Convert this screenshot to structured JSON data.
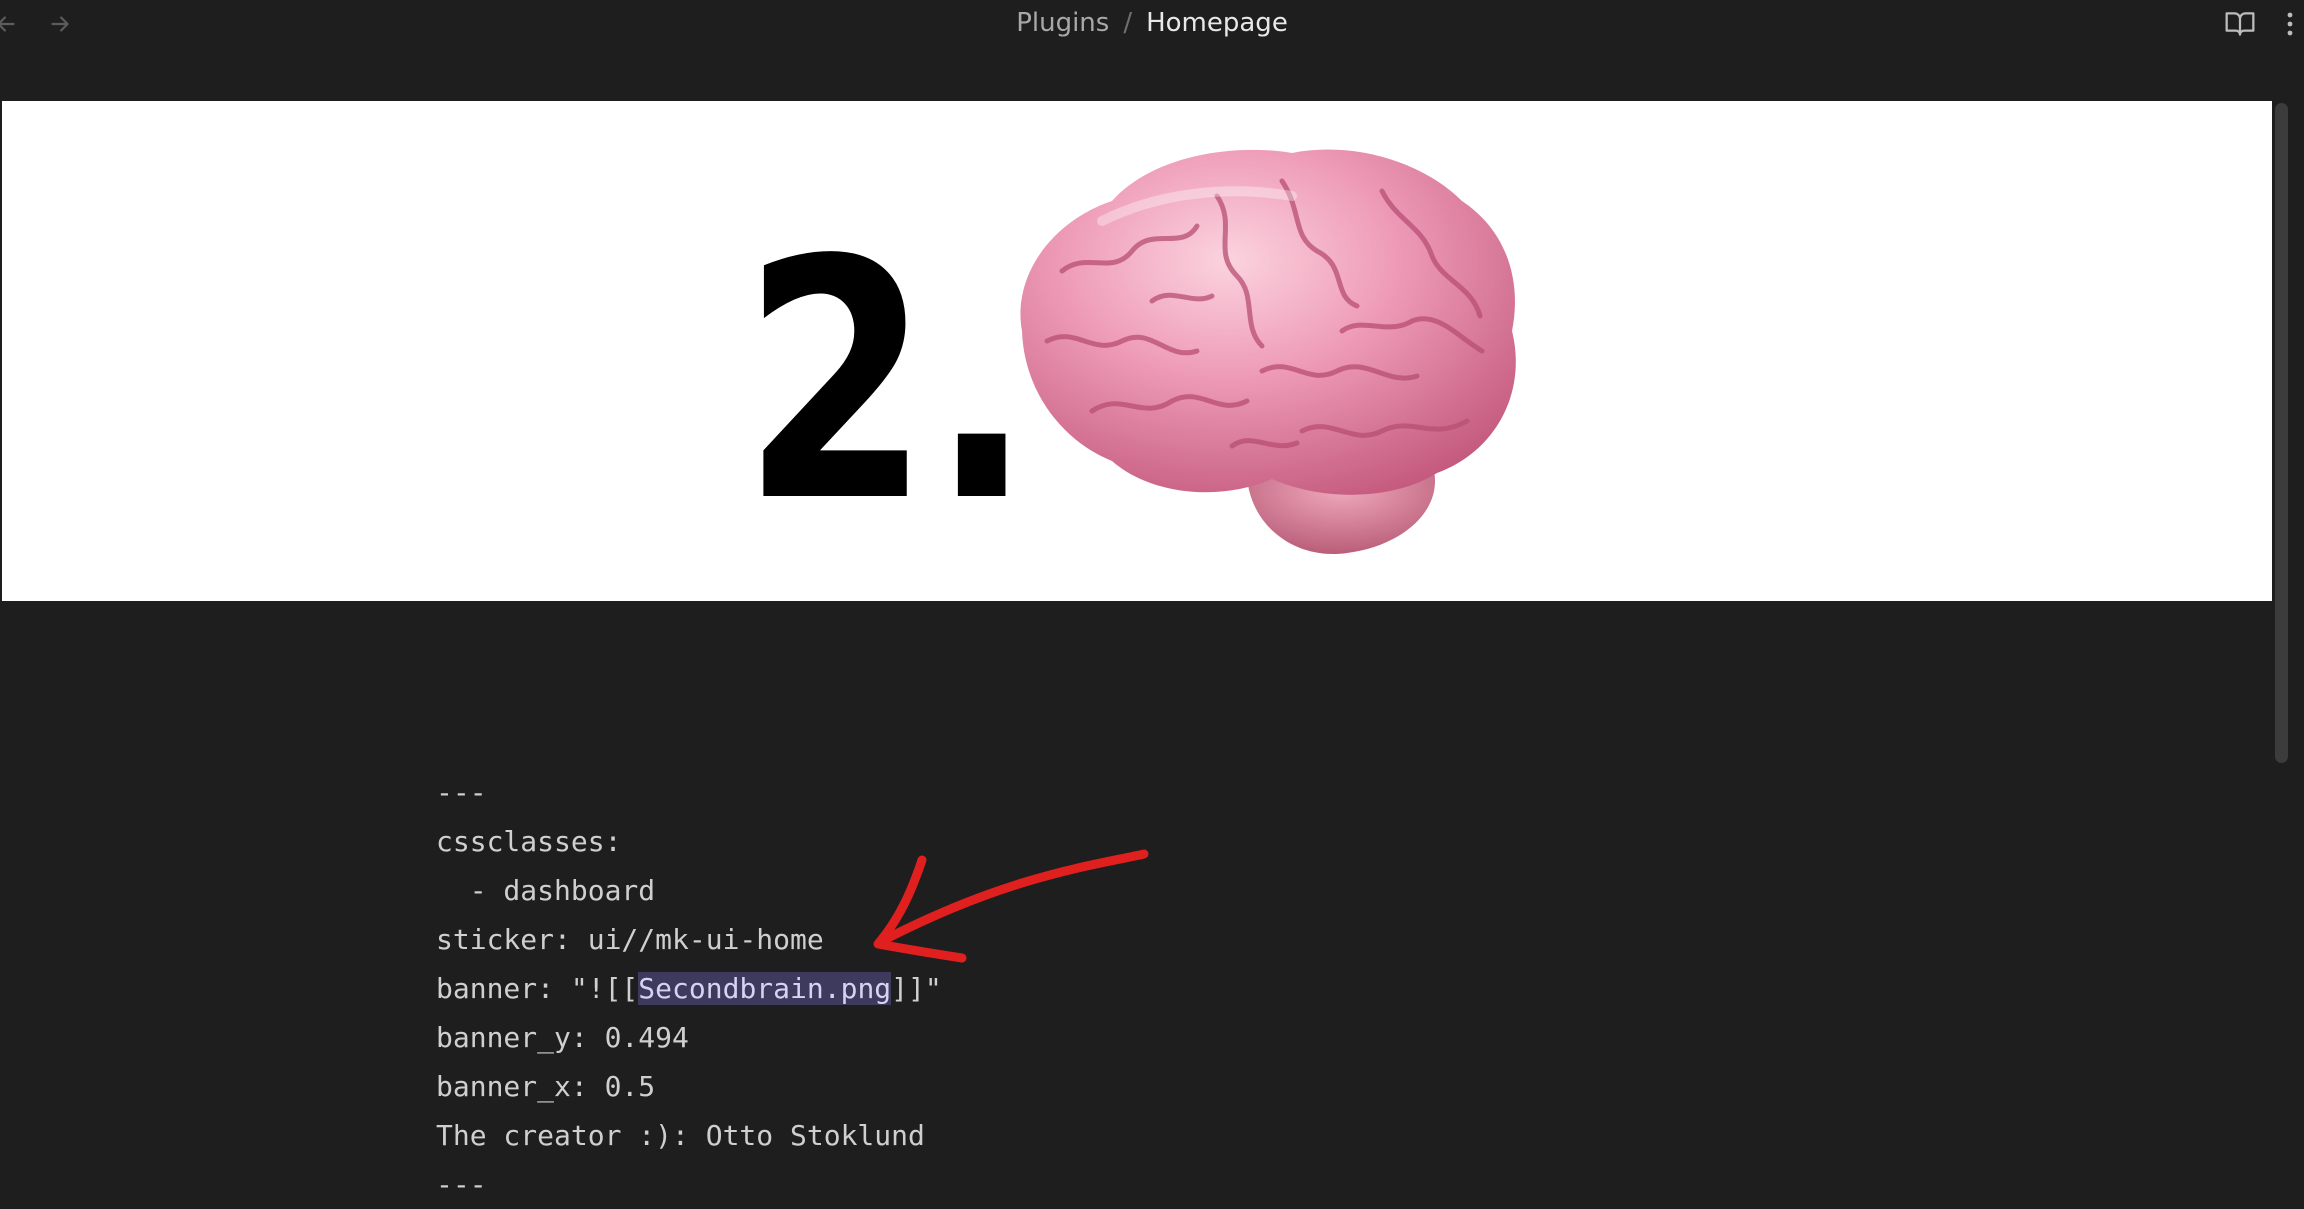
{
  "titlebar": {
    "breadcrumb_parent": "Plugins",
    "breadcrumb_separator": "/",
    "breadcrumb_current": "Homepage",
    "icons": {
      "back": "arrow-left-icon",
      "forward": "arrow-right-icon",
      "reading_view": "book-open-icon",
      "more": "more-vertical-icon"
    }
  },
  "banner": {
    "number_text": "2.",
    "image": "brain-image"
  },
  "frontmatter": {
    "line1": "---",
    "line2": "cssclasses:",
    "line3": "  - dashboard",
    "line4": "sticker: ui//mk-ui-home",
    "line5_prefix": "banner: \"![[",
    "line5_highlight": "Secondbrain.png",
    "line5_suffix": "]]\"",
    "line6": "banner_y: 0.494",
    "line7": "banner_x: 0.5",
    "line8": "The creator :): Otto Stoklund",
    "line9": "---"
  },
  "colors": {
    "background": "#1e1e1e",
    "text": "#cfcfcf",
    "highlight": "#3e3a5e",
    "annotation_arrow": "#e0201e",
    "brain_pink": "#e88aa8"
  }
}
